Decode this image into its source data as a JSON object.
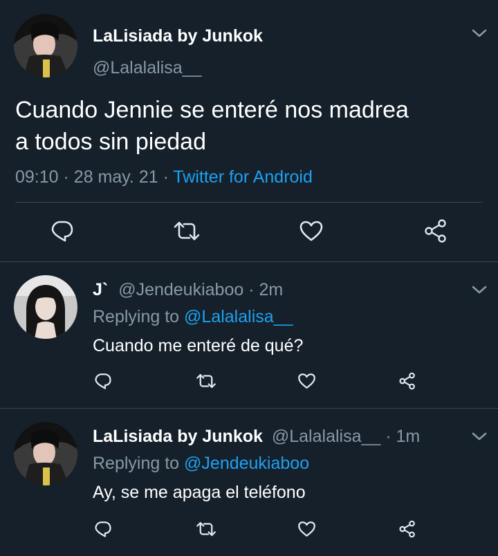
{
  "main_tweet": {
    "display_name": "LaLisiada by Junkok",
    "handle": "@Lalalalisa__",
    "text_line1": "Cuando Jennie se enteré nos madrea",
    "text_line2": "a todos sin piedad",
    "time": "09:10",
    "sep1": "·",
    "date": "28 may. 21",
    "sep2": "·",
    "source": "Twitter for Android",
    "avatar_icon": "profile-photo-lisa",
    "actions": [
      "reply-icon",
      "retweet-icon",
      "like-icon",
      "share-icon"
    ]
  },
  "replies": [
    {
      "display_name": "J`",
      "handle": "@Jendeukiaboo",
      "time": "· 2m",
      "replying_prefix": "Replying to",
      "replying_to": "@Lalalalisa__",
      "text": "Cuando me enteré de qué?",
      "avatar_icon": "profile-photo-jennie"
    },
    {
      "display_name": "LaLisiada by Junkok",
      "handle": "@Lalalalisa__",
      "time": "· 1m",
      "replying_prefix": "Replying to",
      "replying_to": "@Jendeukiaboo",
      "text": "Ay, se me apaga el teléfono",
      "avatar_icon": "profile-photo-lisa"
    }
  ],
  "colors": {
    "background": "#15202b",
    "text": "#ffffff",
    "muted": "#8899a6",
    "link": "#1da1f2",
    "divider": "#38444d"
  }
}
